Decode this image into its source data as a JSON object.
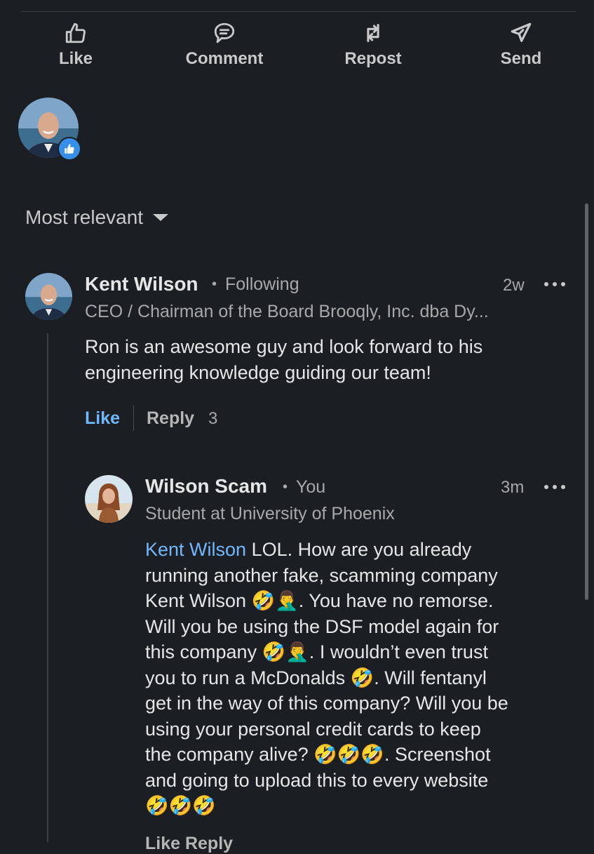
{
  "actions": {
    "like": "Like",
    "comment": "Comment",
    "repost": "Repost",
    "send": "Send"
  },
  "sort": {
    "label": "Most relevant"
  },
  "comments": [
    {
      "author": "Kent Wilson",
      "relation": "Following",
      "headline": "CEO / Chairman of the Board Brooqly, Inc. dba Dy...",
      "time": "2w",
      "text_line1": "Ron is an awesome guy and look forward to his",
      "text_line2": "engineering knowledge guiding our team!",
      "like_label": "Like",
      "reply_label": "Reply",
      "reply_count": "3"
    }
  ],
  "reply": {
    "author": "Wilson Scam",
    "relation": "You",
    "headline": "Student at University of Phoenix",
    "time": "3m",
    "mention": "Kent Wilson",
    "lines": [
      " LOL. How are you already",
      "running another fake, scamming company",
      "Kent Wilson 🤣🤦‍♂️. You have no remorse.",
      "Will you be using the DSF model again for",
      "this company 🤣🤦‍♂️. I wouldn’t even trust",
      "you to run a McDonalds 🤣. Will fentanyl",
      "get in the way of this company? Will you be",
      "using your personal credit cards to keep",
      "the company alive? 🤣🤣🤣. Screenshot",
      "and going to upload this to every website",
      "🤣🤣🤣"
    ],
    "footer_partial": "Like  Reply"
  },
  "colors": {
    "background": "#1b1f23",
    "link_blue": "#71b7fb",
    "like_badge": "#378fe9"
  },
  "icons": [
    "thumbs-up-icon",
    "comment-icon",
    "repost-icon",
    "send-icon",
    "caret-down-icon",
    "more-icon"
  ]
}
